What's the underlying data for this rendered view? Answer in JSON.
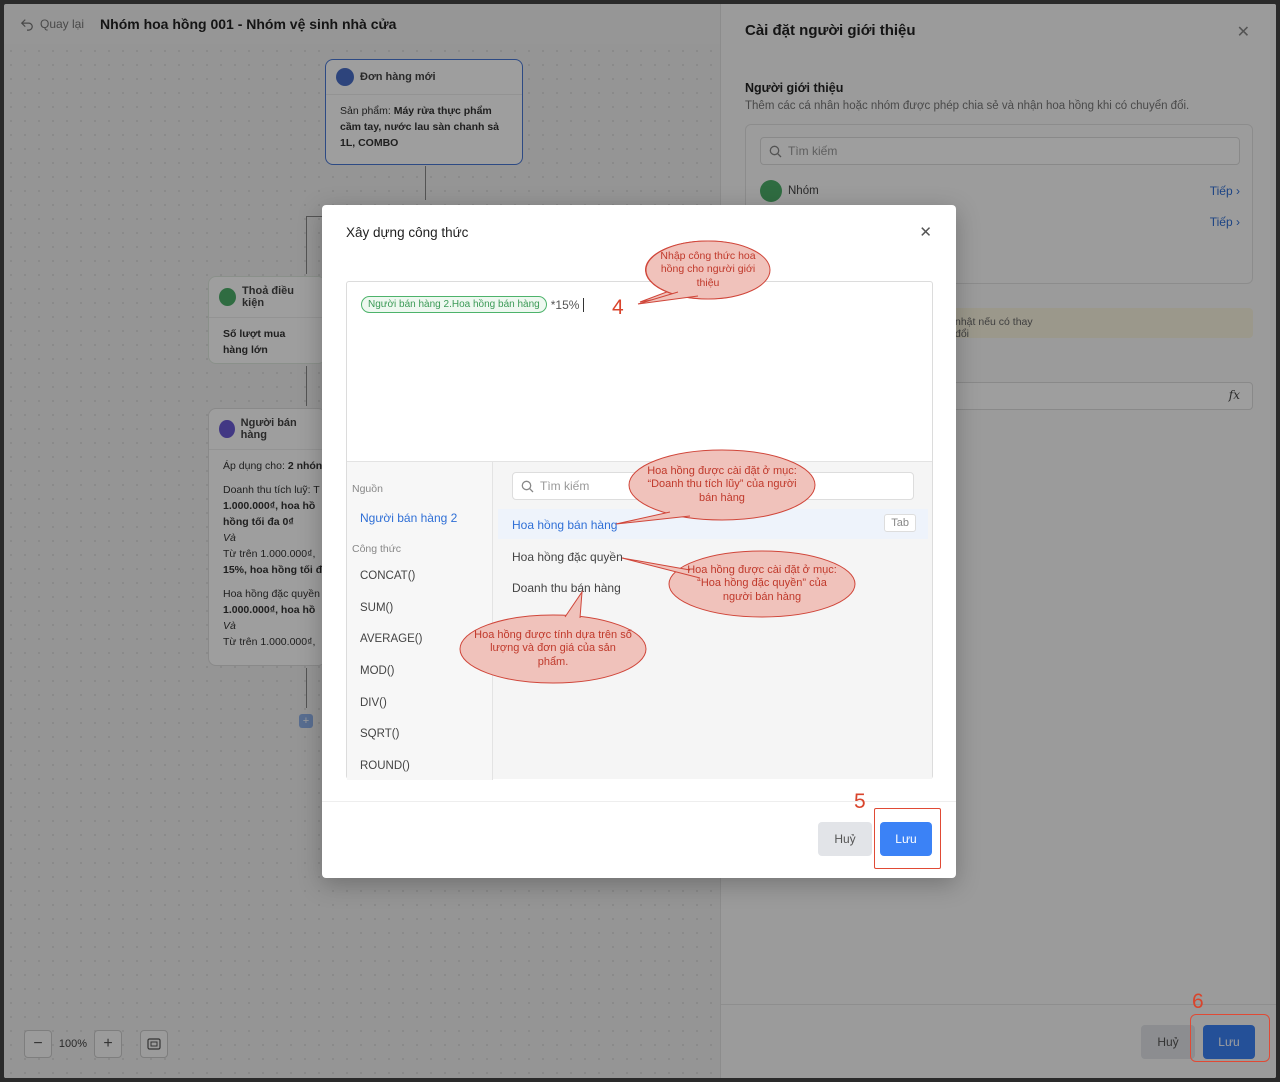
{
  "topbar": {
    "back_label": "Quay lại",
    "title": "Nhóm hoa hồng 001 - Nhóm vệ sinh nhà cửa"
  },
  "flow": {
    "order_node": {
      "title": "Đơn hàng mới",
      "product_prefix": "Sản phẩm: ",
      "product_value": "Máy rửa thực phẩm cầm tay, nước lau sàn chanh sả 1L, COMBO"
    },
    "condition_node": {
      "title": "Thoả điều kiện",
      "body": "Số lượt mua hàng lớn"
    },
    "seller_node": {
      "title": "Người bán hàng",
      "apply_prefix": "Áp dụng cho: ",
      "apply_value": "2 nhón",
      "l1": "Doanh thu tích luỹ: T",
      "l2": "1.000.000₫, hoa hồ",
      "l3": "hồng tối đa 0₫",
      "l4": "Và",
      "l5": "Từ trên 1.000.000₫,",
      "l6": "15%, hoa hồng tối đ",
      "l7": "Hoa hồng đặc quyền",
      "l8": "1.000.000₫, hoa hồ",
      "l9": "Và",
      "l10": "Từ trên 1.000.000₫,"
    },
    "zoom_level": "100%"
  },
  "panel": {
    "title": "Cài đặt người giới thiệu",
    "section_title": "Người giới thiệu",
    "section_desc": "Thêm các cá nhân hoặc nhóm được phép chia sẻ và nhận hoa hồng khi có chuyển đổi.",
    "search_placeholder": "Tìm kiếm",
    "group_label": "Nhóm",
    "next_label_1": "Tiếp",
    "next_label_2": "Tiếp",
    "warning_text": "nhật nếu có thay đổi",
    "fx_icon": "fx",
    "cancel_label": "Huỷ",
    "save_label": "Lưu"
  },
  "modal": {
    "title": "Xây dựng công thức",
    "chip_label": "Người bán hàng 2.Hoa hồng bán hàng",
    "formula_suffix": "*15%",
    "source_group_label": "Nguồn",
    "source_item": "Người bán hàng 2",
    "formula_group_label": "Công thức",
    "functions": [
      "CONCAT()",
      "SUM()",
      "AVERAGE()",
      "MOD()",
      "DIV()",
      "SQRT()",
      "ROUND()"
    ],
    "search_placeholder": "Tìm kiếm",
    "fields": [
      "Hoa hồng bán hàng",
      "Hoa hồng đặc quyền",
      "Doanh thu bán hàng"
    ],
    "tab_hint": "Tab",
    "cancel_label": "Huỷ",
    "save_label": "Lưu"
  },
  "annotations": {
    "callout_4": "Nhập công thức hoa hồng cho người giới thiệu",
    "callout_a": "Hoa hồng được cài đặt ở mục: “Doanh thu tích lũy” của người bán hàng",
    "callout_b": "Hoa hồng được cài đặt ở mục: “Hoa hồng đặc quyền” của người bán hàng",
    "callout_c": "Hoa hồng được tính dựa trên số lượng và đơn giá của sản phẩm.",
    "num_4": "4",
    "num_5": "5",
    "num_6": "6"
  },
  "colors": {
    "primary": "#3b82f6",
    "link": "#2f6fd6",
    "annotation": "#d9442c",
    "chip_green": "#4db36b"
  }
}
